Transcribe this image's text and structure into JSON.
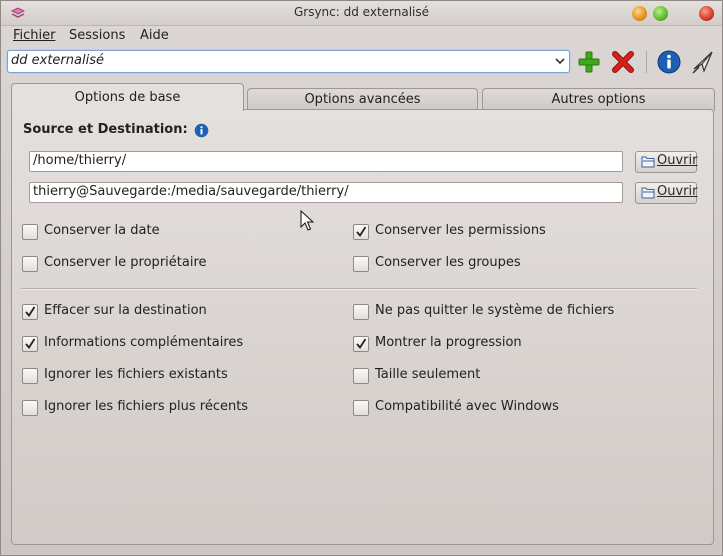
{
  "window": {
    "title": "Grsync: dd externalisé"
  },
  "menubar": {
    "items": [
      {
        "label": "Fichier"
      },
      {
        "label": "Sessions"
      },
      {
        "label": "Aide"
      }
    ]
  },
  "session": {
    "current": "dd externalisé"
  },
  "tabs": [
    {
      "label": "Options de base",
      "active": true
    },
    {
      "label": "Options avancées",
      "active": false
    },
    {
      "label": "Autres options",
      "active": false
    }
  ],
  "main": {
    "section_title": "Source et Destination:",
    "source_path": "/home/thierry/",
    "destination_path": "thierry@Sauvegarde:/media/sauvegarde/thierry/",
    "open_label": "Ouvrir",
    "options": [
      {
        "label": "Conserver la date",
        "checked": false
      },
      {
        "label": "Conserver les permissions",
        "checked": true
      },
      {
        "label": "Conserver le propriétaire",
        "checked": false
      },
      {
        "label": "Conserver les groupes",
        "checked": false
      },
      {
        "label": "Effacer sur la destination",
        "checked": true
      },
      {
        "label": "Ne pas quitter le système de fichiers",
        "checked": false
      },
      {
        "label": "Informations complémentaires",
        "checked": true
      },
      {
        "label": "Montrer la progression",
        "checked": true
      },
      {
        "label": "Ignorer les fichiers existants",
        "checked": false
      },
      {
        "label": "Taille seulement",
        "checked": false
      },
      {
        "label": "Ignorer les fichiers plus récents",
        "checked": false
      },
      {
        "label": "Compatibilité avec Windows",
        "checked": false
      }
    ]
  },
  "toolbar": {
    "icons": [
      "add-session-icon",
      "delete-session-icon",
      "info-icon",
      "execute-icon"
    ]
  },
  "colors": {
    "accent": "#7aa3d1",
    "add": "#3fa81c",
    "delete": "#d8201b",
    "info": "#1d5fb0"
  }
}
